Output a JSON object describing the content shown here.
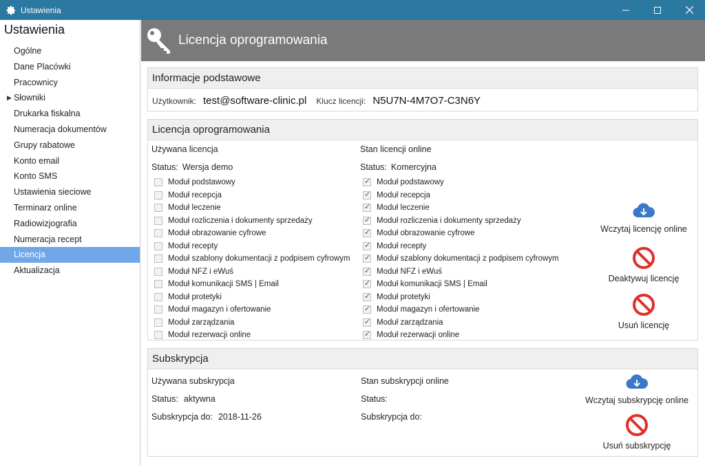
{
  "window": {
    "title": "Ustawienia"
  },
  "sidebar": {
    "title": "Ustawienia",
    "items": [
      {
        "label": "Ogólne"
      },
      {
        "label": "Dane Placówki"
      },
      {
        "label": "Pracownicy"
      },
      {
        "label": "Słowniki"
      },
      {
        "label": "Drukarka fiskalna"
      },
      {
        "label": "Numeracja dokumentów"
      },
      {
        "label": "Grupy rabatowe"
      },
      {
        "label": "Konto email"
      },
      {
        "label": "Konto SMS"
      },
      {
        "label": "Ustawienia sieciowe"
      },
      {
        "label": "Terminarz online"
      },
      {
        "label": "Radiowizjografia"
      },
      {
        "label": "Numeracja recept"
      },
      {
        "label": "Licencja"
      },
      {
        "label": "Aktualizacja"
      }
    ],
    "active": "Licencja"
  },
  "banner": {
    "title": "Licencja oprogramowania",
    "icon": "key-icon"
  },
  "basic_info": {
    "title": "Informacje podstawowe",
    "user_label": "Użytkownik:",
    "user_value": "test@software-clinic.pl",
    "key_label": "Klucz licencji:",
    "key_value": "N5U7N-4M7O7-C3N6Y"
  },
  "license": {
    "title": "Licencja oprogramowania",
    "used": {
      "title": "Używana licencja",
      "status_label": "Status:",
      "status_value": "Wersja demo"
    },
    "online": {
      "title": "Stan licencji online",
      "status_label": "Status:",
      "status_value": "Komercyjna"
    },
    "modules": [
      "Moduł podstawowy",
      "Moduł recepcja",
      "Moduł leczenie",
      "Moduł rozliczenia i dokumenty sprzedaży",
      "Moduł obrazowanie cyfrowe",
      "Moduł recepty",
      "Moduł szablony dokumentacji z podpisem cyfrowym",
      "Moduł NFZ i eWuś",
      "Moduł komunikacji SMS | Email",
      "Moduł protetyki",
      "Moduł magazyn i ofertowanie",
      "Moduł zarządzania",
      "Moduł rezerwacji online"
    ],
    "used_checked": [
      false,
      false,
      false,
      false,
      false,
      false,
      false,
      false,
      false,
      false,
      false,
      false,
      false
    ],
    "online_checked": [
      true,
      true,
      true,
      true,
      true,
      true,
      true,
      true,
      true,
      true,
      true,
      true,
      true
    ],
    "actions": {
      "load": "Wczytaj licencję online",
      "deactivate": "Deaktywuj licencję",
      "remove": "Usuń licencję"
    }
  },
  "subscription": {
    "title": "Subskrypcja",
    "used": {
      "title": "Używana subskrypcja",
      "status_label": "Status:",
      "status_value": "aktywna",
      "until_label": "Subskrypcja do:",
      "until_value": "2018-11-26"
    },
    "online": {
      "title": "Stan subskrypcji online",
      "status_label": "Status:",
      "status_value": "",
      "until_label": "Subskrypcja do:",
      "until_value": ""
    },
    "actions": {
      "load": "Wczytaj subskrypcję online",
      "remove": "Usuń subskrypcję"
    }
  },
  "colors": {
    "titlebar": "#2b78a0",
    "banner": "#7a7a7a",
    "active_item": "#6fa7e8",
    "cloud_icon": "#3a78c8",
    "stop_icon": "#e0302a"
  }
}
